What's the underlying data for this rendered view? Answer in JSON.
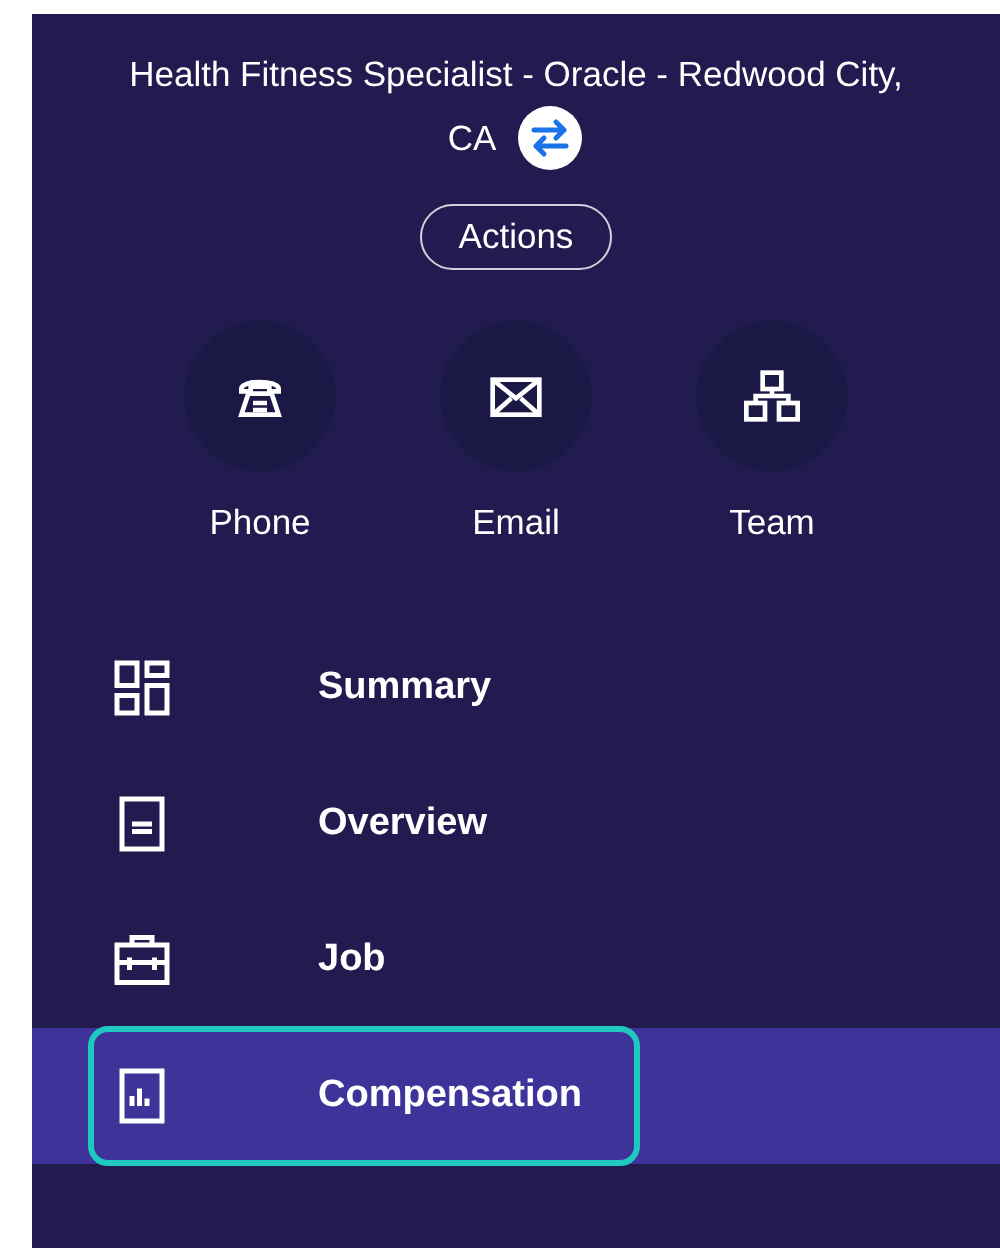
{
  "header": {
    "title_line_1": "Health Fitness Specialist - Oracle - Redwood City,",
    "title_line_2": "CA",
    "actions_button": "Actions"
  },
  "contact_actions": [
    {
      "kind": "phone",
      "label": "Phone"
    },
    {
      "kind": "email",
      "label": "Email"
    },
    {
      "kind": "team",
      "label": "Team"
    }
  ],
  "nav_items": [
    {
      "kind": "summary",
      "label": "Summary",
      "selected": false
    },
    {
      "kind": "overview",
      "label": "Overview",
      "selected": false
    },
    {
      "kind": "job",
      "label": "Job",
      "selected": false
    },
    {
      "kind": "compensation",
      "label": "Compensation",
      "selected": true
    }
  ]
}
